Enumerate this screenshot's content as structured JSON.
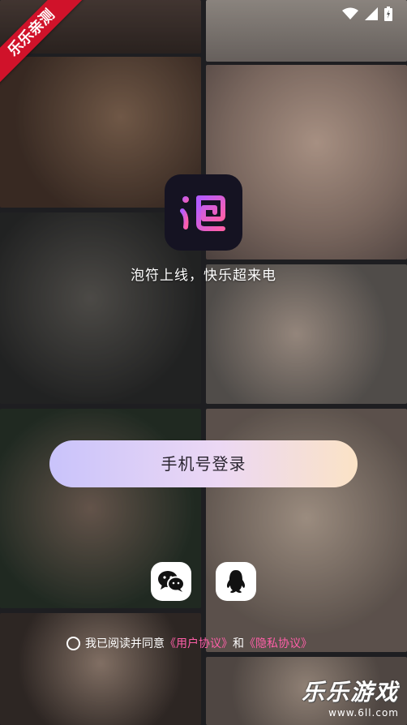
{
  "ribbon": {
    "text": "乐乐亲测"
  },
  "app": {
    "logo_char": "泡",
    "tagline": "泡符上线，快乐超来电"
  },
  "login": {
    "phone_button": "手机号登录"
  },
  "social": {
    "wechat": "wechat-icon",
    "qq": "qq-icon"
  },
  "agreement": {
    "prefix": "我已阅读并同意",
    "user_terms": "《用户协议》",
    "and": "和",
    "privacy": "《隐私协议》"
  },
  "watermark": {
    "title": "乐乐游戏",
    "url": "www.6ll.com"
  },
  "colors": {
    "accent": "#ff5fa8",
    "ribbon": "#d0122a",
    "logo_bg": "#151322"
  }
}
